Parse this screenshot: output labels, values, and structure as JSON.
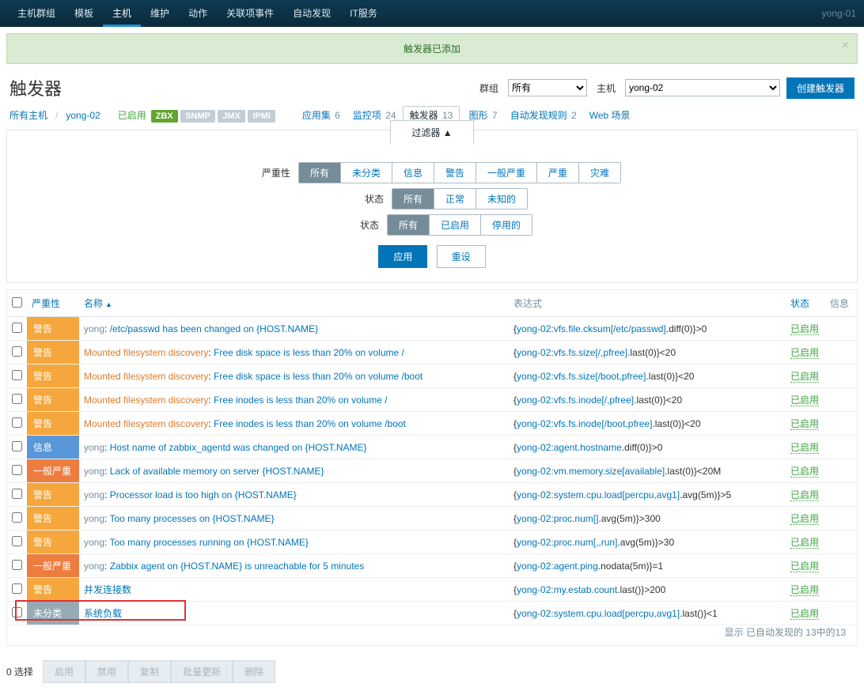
{
  "topnav": {
    "items": [
      "主机群组",
      "模板",
      "主机",
      "维护",
      "动作",
      "关联项事件",
      "自动发现",
      "IT服务"
    ],
    "active": 2,
    "user": "yong-01"
  },
  "banner": {
    "msg": "触发器已添加"
  },
  "page": {
    "title": "触发器"
  },
  "toolbar": {
    "group_label": "群组",
    "group_value": "所有",
    "host_label": "主机",
    "host_value": "yong-02",
    "create": "创建触发器"
  },
  "subnav": {
    "all_hosts": "所有主机",
    "host": "yong-02",
    "enabled": "已启用",
    "badges": [
      "ZBX",
      "SNMP",
      "JMX",
      "IPMI"
    ],
    "links": [
      {
        "t": "应用集",
        "c": "6"
      },
      {
        "t": "监控项",
        "c": "24"
      },
      {
        "t": "触发器",
        "c": "13",
        "active": true
      },
      {
        "t": "图形",
        "c": "7"
      },
      {
        "t": "自动发现规则",
        "c": "2"
      },
      {
        "t": "Web 场景",
        "c": ""
      }
    ]
  },
  "filter": {
    "tab": "过滤器 ▲",
    "rows": [
      {
        "label": "严重性",
        "opts": [
          "所有",
          "未分类",
          "信息",
          "警告",
          "一般严重",
          "严重",
          "灾难"
        ],
        "sel": 0
      },
      {
        "label": "状态",
        "opts": [
          "所有",
          "正常",
          "未知的"
        ],
        "sel": 0
      },
      {
        "label": "状态",
        "opts": [
          "所有",
          "已启用",
          "停用的"
        ],
        "sel": 0
      }
    ],
    "apply": "应用",
    "reset": "重设"
  },
  "cols": {
    "sev": "严重性",
    "name": "名称",
    "expr": "表达式",
    "status": "状态",
    "info": "信息"
  },
  "rows": [
    {
      "sev": "警告",
      "sc": "warn",
      "pre": "yong",
      "name": "/etc/passwd has been changed on {HOST.NAME}",
      "el": "yong-02:vfs.file.cksum[/etc/passwd]",
      "et": ".diff(0)}>0",
      "st": "已启用"
    },
    {
      "sev": "警告",
      "sc": "warn",
      "pre2": "Mounted filesystem discovery",
      "name": "Free disk space is less than 20% on volume /",
      "el": "yong-02:vfs.fs.size[/,pfree]",
      "et": ".last(0)}<20",
      "st": "已启用"
    },
    {
      "sev": "警告",
      "sc": "warn",
      "pre2": "Mounted filesystem discovery",
      "name": "Free disk space is less than 20% on volume /boot",
      "el": "yong-02:vfs.fs.size[/boot,pfree]",
      "et": ".last(0)}<20",
      "st": "已启用"
    },
    {
      "sev": "警告",
      "sc": "warn",
      "pre2": "Mounted filesystem discovery",
      "name": "Free inodes is less than 20% on volume /",
      "el": "yong-02:vfs.fs.inode[/,pfree]",
      "et": ".last(0)}<20",
      "st": "已启用"
    },
    {
      "sev": "警告",
      "sc": "warn",
      "pre2": "Mounted filesystem discovery",
      "name": "Free inodes is less than 20% on volume /boot",
      "el": "yong-02:vfs.fs.inode[/boot,pfree]",
      "et": ".last(0)}<20",
      "st": "已启用"
    },
    {
      "sev": "信息",
      "sc": "info",
      "pre": "yong",
      "name": "Host name of zabbix_agentd was changed on {HOST.NAME}",
      "el": "yong-02:agent.hostname",
      "et": ".diff(0)}>0",
      "st": "已启用"
    },
    {
      "sev": "一般严重",
      "sc": "avg",
      "pre": "yong",
      "name": "Lack of available memory on server {HOST.NAME}",
      "el": "yong-02:vm.memory.size[available]",
      "et": ".last(0)}<20M",
      "st": "已启用"
    },
    {
      "sev": "警告",
      "sc": "warn",
      "pre": "yong",
      "name": "Processor load is too high on {HOST.NAME}",
      "el": "yong-02:system.cpu.load[percpu,avg1]",
      "et": ".avg(5m)}>5",
      "st": "已启用"
    },
    {
      "sev": "警告",
      "sc": "warn",
      "pre": "yong",
      "name": "Too many processes on {HOST.NAME}",
      "el": "yong-02:proc.num[]",
      "et": ".avg(5m)}>300",
      "st": "已启用"
    },
    {
      "sev": "警告",
      "sc": "warn",
      "pre": "yong",
      "name": "Too many processes running on {HOST.NAME}",
      "el": "yong-02:proc.num[,,run]",
      "et": ".avg(5m)}>30",
      "st": "已启用"
    },
    {
      "sev": "一般严重",
      "sc": "avg",
      "pre": "yong",
      "name": "Zabbix agent on {HOST.NAME} is unreachable for 5 minutes",
      "el": "yong-02:agent.ping",
      "et": ".nodata(5m)}=1",
      "st": "已启用"
    },
    {
      "sev": "警告",
      "sc": "warn",
      "name": "并发连接数",
      "el": "yong-02:my.estab.count",
      "et": ".last()}>200",
      "st": "已启用"
    },
    {
      "sev": "未分类",
      "sc": "none",
      "name": "系统负载",
      "el": "yong-02:system.cpu.load[percpu,avg1]",
      "et": ".last()}<1",
      "st": "已启用",
      "hl": true
    }
  ],
  "footer_right": "显示 已自动发现的 13中的13",
  "footer": {
    "sel": "0 选择",
    "btns": [
      "启用",
      "禁用",
      "复制",
      "批量更新",
      "删除"
    ]
  }
}
